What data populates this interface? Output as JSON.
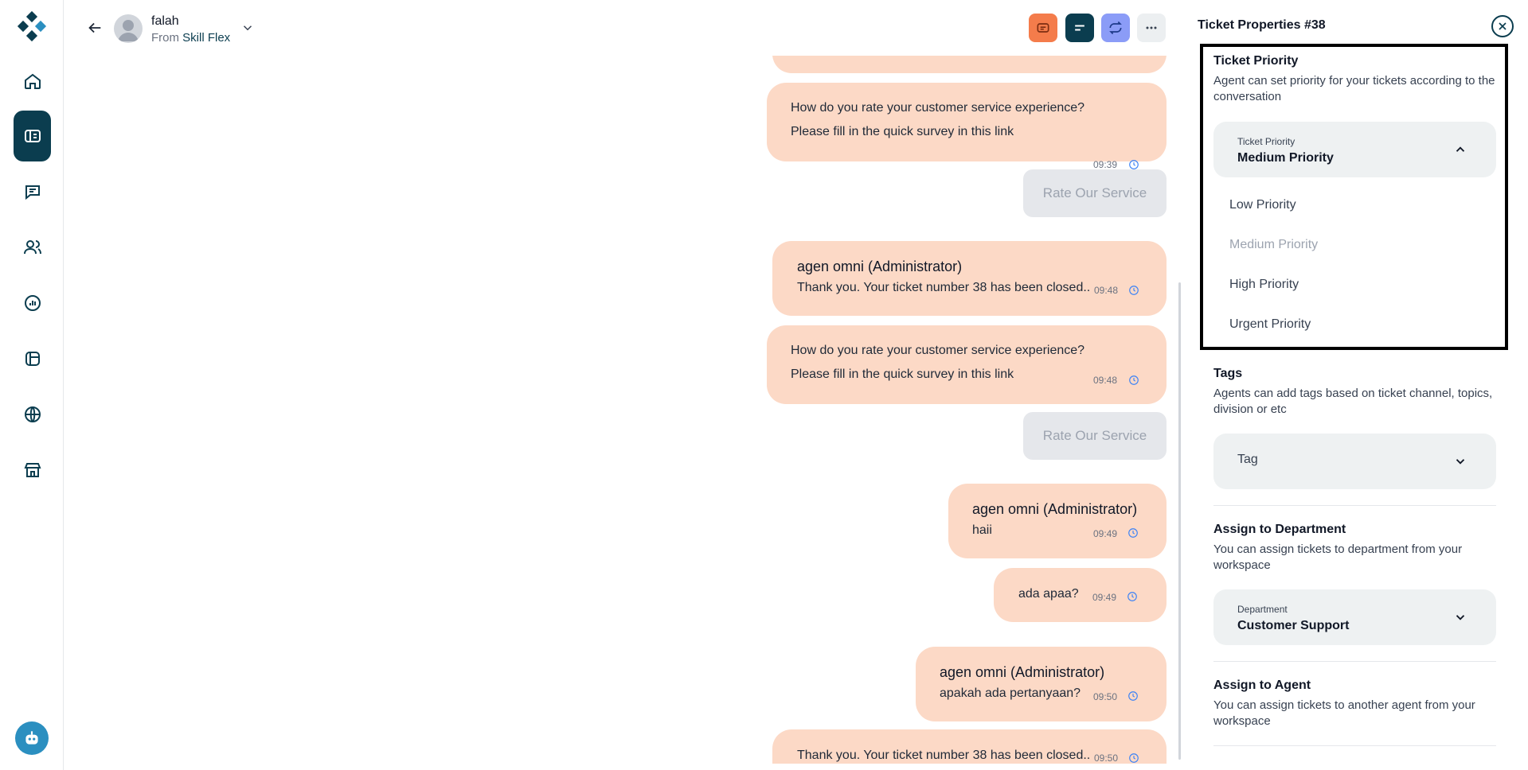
{
  "header": {
    "customer_name": "falah",
    "from_label": "From",
    "from_source": "Skill Flex"
  },
  "messages": [
    {
      "id": "m1",
      "line1": "How do you rate your customer service experience?",
      "line2": "Please fill in the quick survey in this link",
      "time": "09:39"
    },
    {
      "id": "m2",
      "button": "Rate Our Service"
    },
    {
      "id": "m3",
      "name": "agen omni (Administrator)",
      "text": "Thank you. Your ticket number 38 has been closed..",
      "time": "09:48"
    },
    {
      "id": "m4",
      "line1": "How do you rate your customer service experience?",
      "line2": "Please fill in the quick survey in this link",
      "time": "09:48"
    },
    {
      "id": "m5",
      "button": "Rate Our Service"
    },
    {
      "id": "m6",
      "name": "agen omni (Administrator)",
      "text": "haii",
      "time": "09:49"
    },
    {
      "id": "m7",
      "text": "ada apaa?",
      "time": "09:49"
    },
    {
      "id": "m8",
      "name": "agen omni (Administrator)",
      "text": "apakah ada pertanyaan?",
      "time": "09:50"
    },
    {
      "id": "m9",
      "text": "Thank you. Your ticket number 38 has been closed..",
      "time": "09:50"
    }
  ],
  "panel": {
    "title": "Ticket Properties #38",
    "priority": {
      "title": "Ticket Priority",
      "desc": "Agent can set priority for your tickets according to the conversation",
      "field_label": "Ticket Priority",
      "value": "Medium Priority",
      "options": [
        "Low Priority",
        "Medium Priority",
        "High Priority",
        "Urgent Priority"
      ]
    },
    "tags": {
      "title": "Tags",
      "desc": "Agents can add tags based on ticket channel, topics, division or etc",
      "placeholder": "Tag"
    },
    "department": {
      "title": "Assign to Department",
      "desc": "You can assign tickets to department from your workspace",
      "field_label": "Department",
      "value": "Customer Support"
    },
    "agent": {
      "title": "Assign to Agent",
      "desc": "You can assign tickets to another agent from your workspace"
    }
  },
  "colors": {
    "brand": "#0b3d4f",
    "bubble": "#fcd9c6",
    "orange_button": "#f47c4b",
    "purple_button": "#8b9cf7"
  }
}
